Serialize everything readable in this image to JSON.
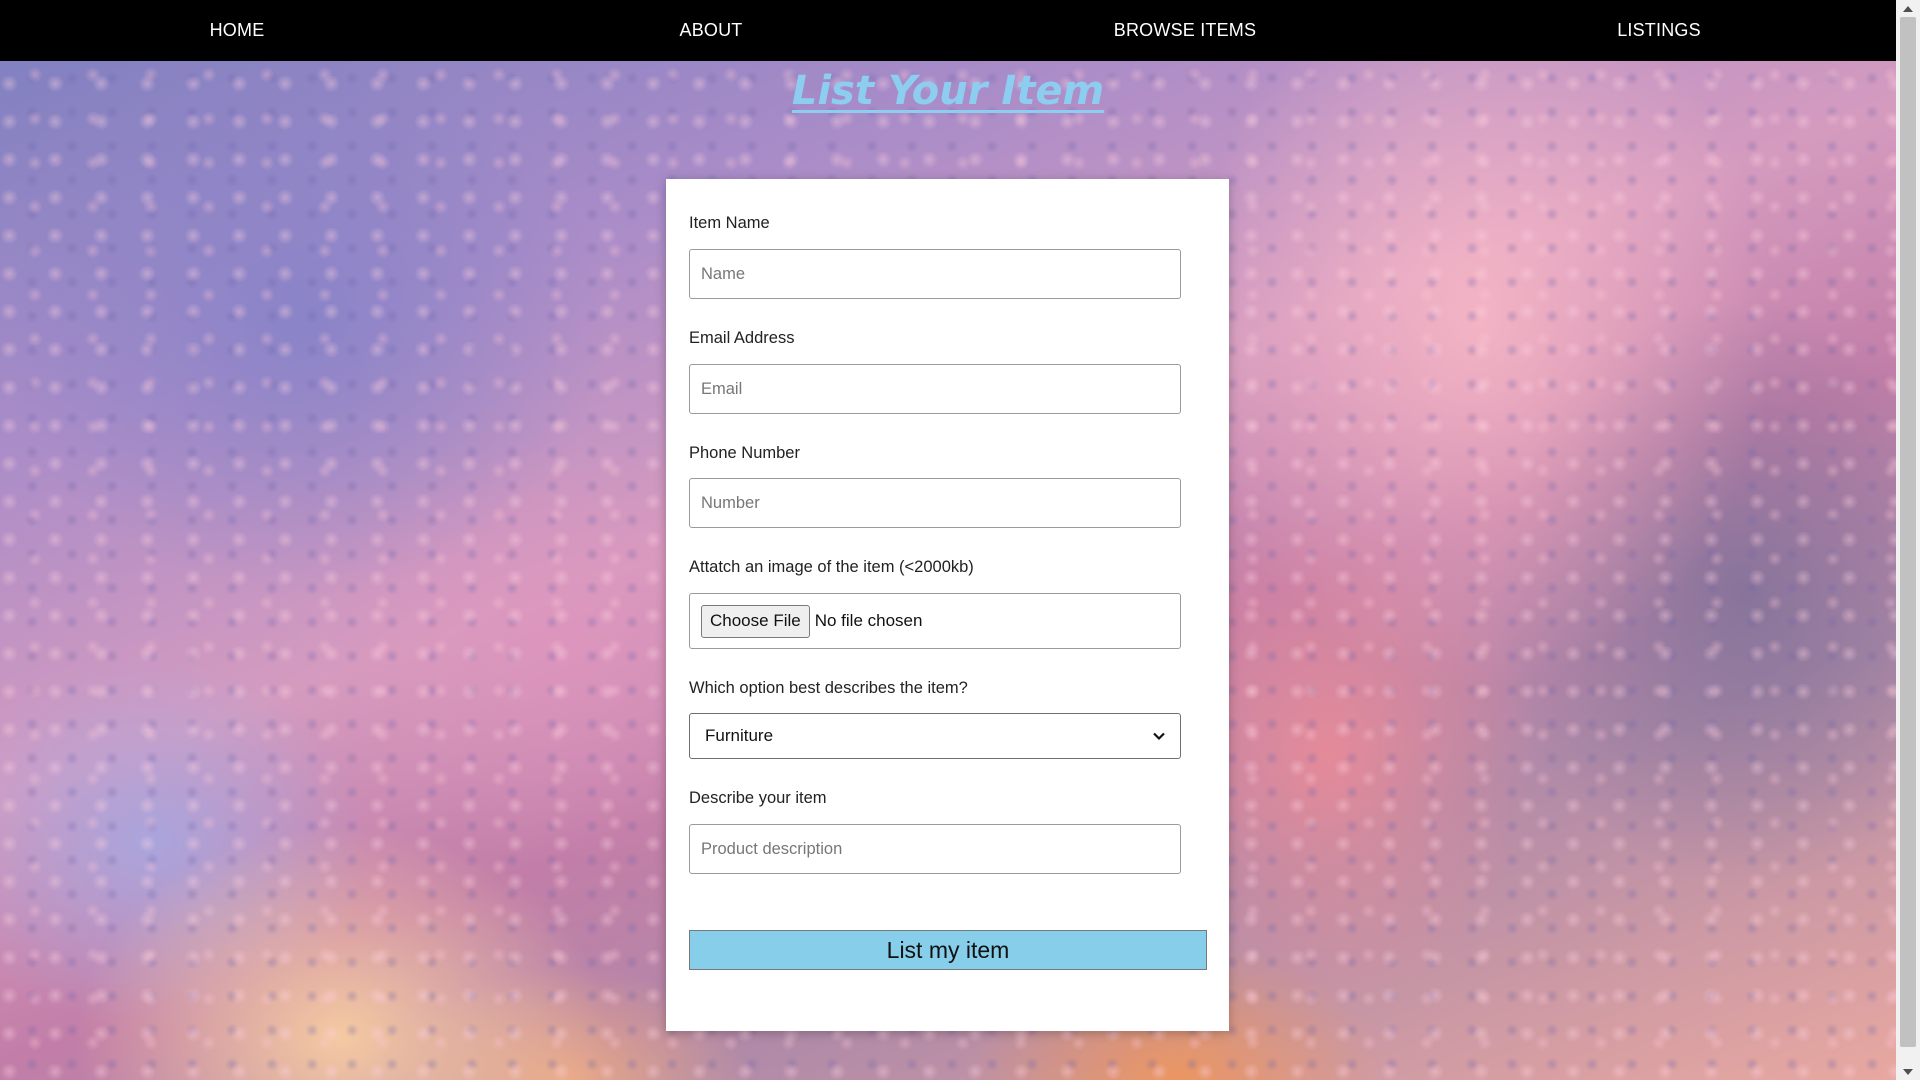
{
  "nav": {
    "items": [
      {
        "label": "HOME"
      },
      {
        "label": "ABOUT"
      },
      {
        "label": "BROWSE ITEMS"
      },
      {
        "label": "LISTINGS"
      }
    ]
  },
  "page": {
    "title": "List Your Item"
  },
  "form": {
    "name": {
      "label": "Item Name",
      "placeholder": "Name"
    },
    "email": {
      "label": "Email Address",
      "placeholder": "Email"
    },
    "phone": {
      "label": "Phone Number",
      "placeholder": "Number"
    },
    "image": {
      "label": "Attatch an image of the item (<2000kb)",
      "button_label": "Choose File",
      "status": "No file chosen"
    },
    "category": {
      "label": "Which option best describes the item?",
      "selected": "Furniture"
    },
    "description": {
      "label": "Describe your item",
      "placeholder": "Product description"
    },
    "submit_label": "List my item"
  },
  "colors": {
    "nav_background": "#000000",
    "title": "#8ccdf0",
    "submit_background": "#87ceeb"
  },
  "icons": {
    "select_arrow": "chevron-down-icon",
    "scroll_up": "scroll-up-arrow-icon",
    "scroll_down": "scroll-down-arrow-icon"
  }
}
